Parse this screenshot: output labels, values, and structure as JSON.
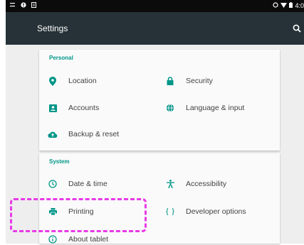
{
  "status_bar": {
    "time": "4:0"
  },
  "toolbar": {
    "title": "Settings"
  },
  "sections": {
    "personal": {
      "title": "Personal",
      "items": {
        "location": "Location",
        "security": "Security",
        "accounts": "Accounts",
        "language": "Language & input",
        "backup": "Backup & reset"
      }
    },
    "system": {
      "title": "System",
      "items": {
        "datetime": "Date & time",
        "accessibility": "Accessibility",
        "printing": "Printing",
        "developer": "Developer options",
        "about": "About tablet"
      }
    }
  },
  "colors": {
    "toolbar": "#263238",
    "accent": "#009688",
    "annotation": "#e83ae6"
  }
}
